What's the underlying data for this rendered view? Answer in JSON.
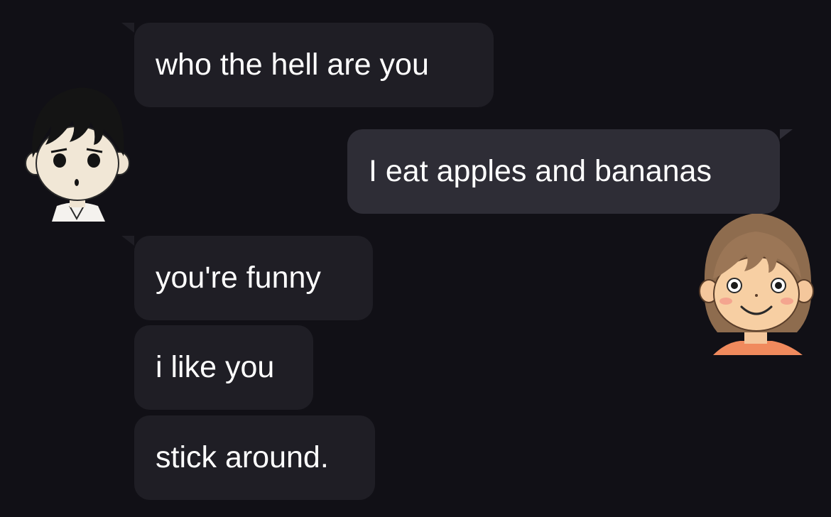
{
  "colors": {
    "background": "#111016",
    "incoming_bubble": "#1f1e25",
    "outgoing_bubble": "#2e2d36",
    "text": "#ffffff"
  },
  "participants": {
    "left_avatar": {
      "icon": "black-haired-boy-avatar-icon"
    },
    "right_avatar": {
      "icon": "brown-haired-boy-avatar-icon"
    }
  },
  "messages": [
    {
      "sender": "left",
      "text": "who the hell are you"
    },
    {
      "sender": "right",
      "text": "I eat apples and bananas"
    },
    {
      "sender": "left",
      "text": "you're funny"
    },
    {
      "sender": "left",
      "text": "i like you"
    },
    {
      "sender": "left",
      "text": "stick around."
    }
  ]
}
